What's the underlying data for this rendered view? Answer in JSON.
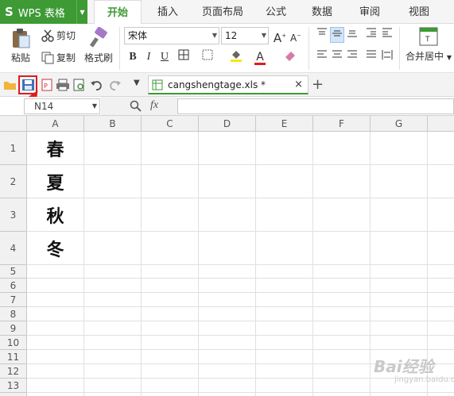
{
  "app": {
    "name": "WPS 表格",
    "logo": "S"
  },
  "tabs": [
    {
      "label": "开始",
      "active": true
    },
    {
      "label": "插入"
    },
    {
      "label": "页面布局"
    },
    {
      "label": "公式"
    },
    {
      "label": "数据"
    },
    {
      "label": "审阅"
    },
    {
      "label": "视图"
    }
  ],
  "ribbon": {
    "paste_label": "粘贴",
    "cut_label": "剪切",
    "copy_label": "复制",
    "format_painter_label": "格式刷",
    "font_name": "宋体",
    "font_size": "12",
    "bold": "B",
    "italic": "I",
    "underline": "U",
    "grow_font": "A",
    "shrink_font": "A",
    "font_color_letter": "A",
    "merge_center_label": "合并居中"
  },
  "quickbar": {
    "file_tab": "cangshengtage.xls *",
    "close": "×",
    "new_tab": "+"
  },
  "formula_bar": {
    "name_box": "N14",
    "fx": "fx"
  },
  "sheet": {
    "columns": [
      "A",
      "B",
      "C",
      "D",
      "E",
      "F",
      "G"
    ],
    "rows": [
      "1",
      "2",
      "3",
      "4",
      "5",
      "6",
      "7",
      "8",
      "9",
      "10",
      "11",
      "12",
      "13"
    ],
    "cells": {
      "A1": "春",
      "A2": "夏",
      "A3": "秋",
      "A4": "冬"
    }
  },
  "watermark": {
    "text": "Bai经验",
    "sub": "jingyan.baidu.com"
  },
  "colors": {
    "accent": "#3d9a35",
    "highlight": "#e01c1c"
  }
}
